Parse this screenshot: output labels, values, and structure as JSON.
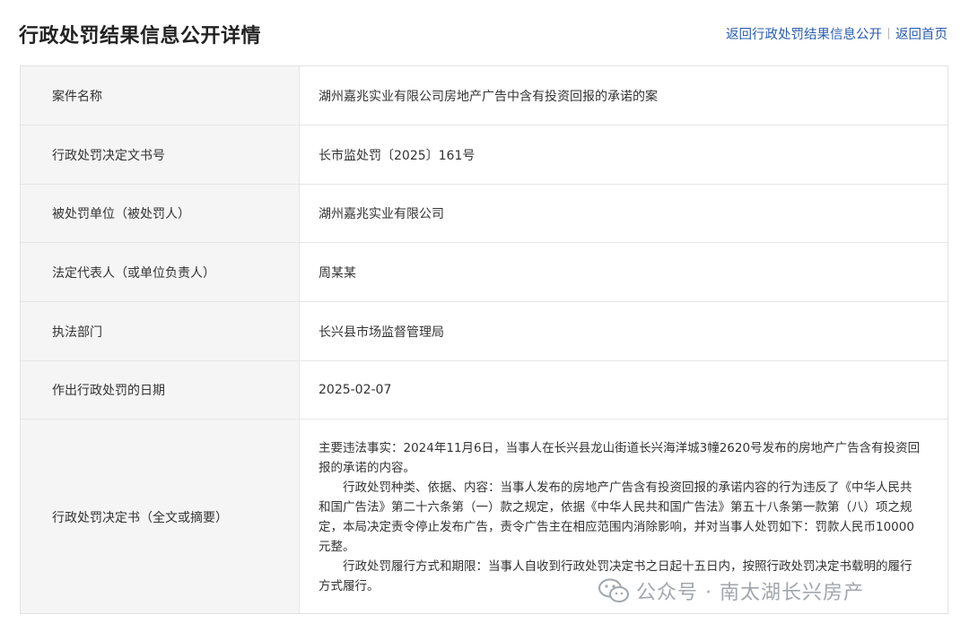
{
  "header": {
    "title": "行政处罚结果信息公开详情",
    "link_back_list": "返回行政处罚结果信息公开",
    "link_home": "返回首页",
    "link_color": "#2a5db0"
  },
  "rows": [
    {
      "label": "案件名称",
      "value": "湖州嘉兆实业有限公司房地产广告中含有投资回报的承诺的案"
    },
    {
      "label": "行政处罚决定文书号",
      "value": "长市监处罚〔2025〕161号"
    },
    {
      "label": "被处罚单位（被处罚人）",
      "value": "湖州嘉兆实业有限公司"
    },
    {
      "label": "法定代表人（或单位负责人）",
      "value": "周某某"
    },
    {
      "label": "执法部门",
      "value": "长兴县市场监督管理局"
    },
    {
      "label": "作出行政处罚的日期",
      "value": "2025-02-07"
    },
    {
      "label": "行政处罚决定书（全文或摘要）"
    }
  ],
  "decision": {
    "p1": "主要违法事实：2024年11月6日，当事人在长兴县龙山街道长兴海洋城3幢2620号发布的房地产广告含有投资回报的承诺的内容。",
    "p2": "行政处罚种类、依据、内容：当事人发布的房地产广告含有投资回报的承诺内容的行为违反了《中华人民共和国广告法》第二十六条第（一）款之规定，依据《中华人民共和国广告法》第五十八条第一款第（八）项之规定，本局决定责令停止发布广告，责令广告主在相应范围内消除影响，并对当事人处罚如下：罚款人民币10000元整。",
    "p3": "行政处罚履行方式和期限：当事人自收到行政处罚决定书之日起十五日内，按照行政处罚决定书载明的履行方式履行。"
  },
  "watermark": {
    "text": "公众号 · 南太湖长兴房产",
    "icon": "wechat-icon"
  }
}
